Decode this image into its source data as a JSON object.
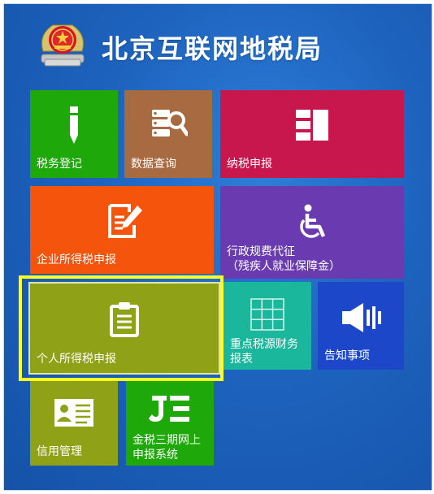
{
  "header": {
    "title": "北京互联网地税局"
  },
  "colors": {
    "background": "#1d63be",
    "highlight_border": "#ffff22"
  },
  "tiles": [
    {
      "label": "税务登记",
      "color": "#1ea80a",
      "icon": "pen-icon"
    },
    {
      "label": "数据查询",
      "color": "#a86a40",
      "icon": "database-search-icon"
    },
    {
      "label": "纳税申报",
      "color": "#c8174d",
      "icon": "report-columns-icon"
    },
    {
      "label": "企业所得税申报",
      "color": "#f4540c",
      "icon": "document-edit-icon"
    },
    {
      "label": "行政规费代征",
      "label2": "（残疾人就业保障金）",
      "color": "#6a3ab0",
      "icon": "wheelchair-icon"
    },
    {
      "label": "个人所得税申报",
      "color": "#8fa217",
      "icon": "clipboard-icon"
    },
    {
      "label": "重点税源财务",
      "label2": "报表",
      "color": "#1ab79c",
      "icon": "grid-table-icon"
    },
    {
      "label": "告知事项",
      "color": "#1b47c8",
      "icon": "speaker-icon"
    },
    {
      "label": "信用管理",
      "color": "#8fa217",
      "icon": "id-card-icon"
    },
    {
      "label": "金税三期网上",
      "label2": "申报系统",
      "color": "#1ea80a",
      "icon": "jinshui-logo-icon"
    }
  ]
}
